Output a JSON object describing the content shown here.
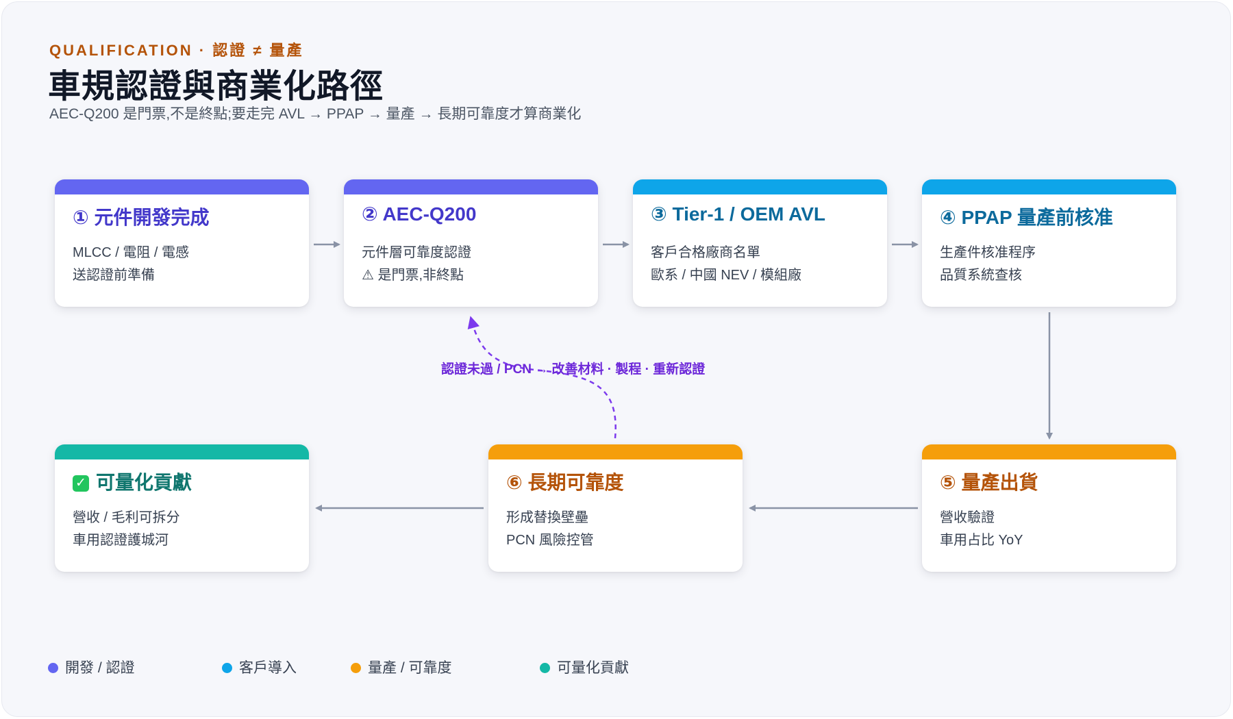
{
  "header": {
    "eyebrow": "QUALIFICATION · 認證 ≠ 量產",
    "title": "車規認證與商業化路徑",
    "subtitle": "AEC-Q200 是門票,不是終點;要走完 AVL → PPAP → 量產 → 長期可靠度才算商業化"
  },
  "colors": {
    "dev": "#6366f1",
    "customer": "#0ea5e9",
    "production": "#f59e0b",
    "contribution": "#14b8a6",
    "arrow": "#8a93a6",
    "loop": "#7c3aed"
  },
  "steps": [
    {
      "title": "① 元件開發完成",
      "line1": "MLCC / 電阻 / 電感",
      "line2": "送認證前準備",
      "category": "dev",
      "title_color": "#4338ca"
    },
    {
      "title": "② AEC-Q200",
      "line1": "元件層可靠度認證",
      "line2": "⚠ 是門票,非終點",
      "category": "dev",
      "title_color": "#4338ca"
    },
    {
      "title": "③ Tier-1 / OEM AVL",
      "line1": "客戶合格廠商名單",
      "line2": "歐系 / 中國 NEV / 模組廠",
      "category": "customer",
      "title_color": "#0c6a9c"
    },
    {
      "title": "④ PPAP 量產前核准",
      "line1": "生產件核准程序",
      "line2": "品質系統查核",
      "category": "customer",
      "title_color": "#0c6a9c"
    },
    {
      "title": "⑤ 量產出貨",
      "line1": "營收驗證",
      "line2": "車用占比 YoY",
      "category": "production",
      "title_color": "#b45309"
    },
    {
      "title": "⑥ 長期可靠度",
      "line1": "形成替換壁壘",
      "line2": "PCN 風險控管",
      "category": "production",
      "title_color": "#b45309"
    },
    {
      "title": "可量化貢獻",
      "line1": "營收 / 毛利可拆分",
      "line2": "車用認證護城河",
      "category": "contribution",
      "title_color": "#0f766e",
      "icon": "check-icon"
    }
  ],
  "loop": {
    "label": "認證未過 / PCN → 改善材料 · 製程 · 重新認證"
  },
  "legend": [
    {
      "label": "開發 / 認證",
      "color": "#6366f1"
    },
    {
      "label": "客戶導入",
      "color": "#0ea5e9"
    },
    {
      "label": "量產 / 可靠度",
      "color": "#f59e0b"
    },
    {
      "label": "可量化貢獻",
      "color": "#14b8a6"
    }
  ]
}
